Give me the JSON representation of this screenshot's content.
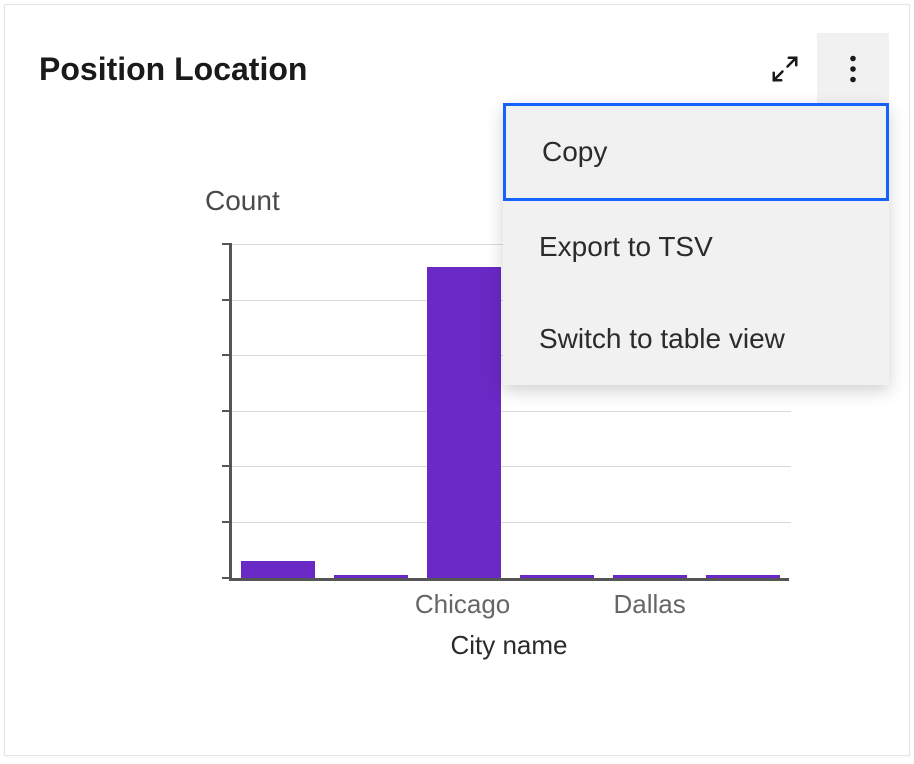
{
  "card": {
    "title": "Position Location"
  },
  "menu": {
    "items": [
      {
        "label": "Copy"
      },
      {
        "label": "Export to TSV"
      },
      {
        "label": "Switch to table view"
      }
    ]
  },
  "chart_data": {
    "type": "bar",
    "title": "Position Location",
    "xlabel": "City name",
    "ylabel": "Count",
    "ylim": [
      0,
      6
    ],
    "grid": true,
    "categories": [
      "",
      "",
      "Chicago",
      "",
      "Dallas",
      ""
    ],
    "values": [
      0.3,
      0.05,
      5.6,
      0.05,
      0.05,
      0.05
    ],
    "color": "#6929c4"
  }
}
